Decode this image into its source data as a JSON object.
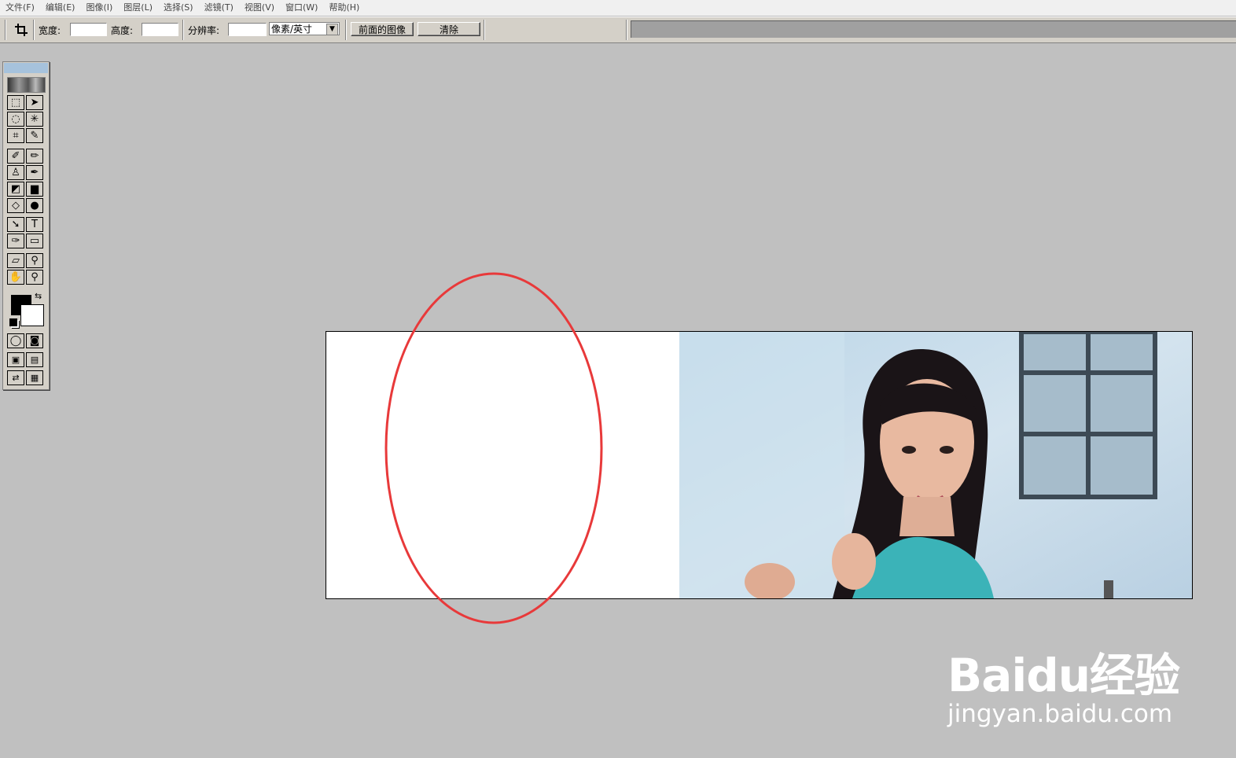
{
  "menubar": {
    "items": [
      "文件(F)",
      "编辑(E)",
      "图像(I)",
      "图层(L)",
      "选择(S)",
      "滤镜(T)",
      "视图(V)",
      "窗口(W)",
      "帮助(H)"
    ]
  },
  "options_bar": {
    "width_label": "宽度:",
    "width_value": "",
    "height_label": "高度:",
    "height_value": "",
    "resolution_label": "分辨率:",
    "resolution_value": "",
    "unit_select": "像素/英寸",
    "front_image_button": "前面的图像",
    "clear_button": "清除"
  },
  "toolbox": {
    "tools": [
      {
        "name": "marquee-tool",
        "glyph": "⬚"
      },
      {
        "name": "move-tool",
        "glyph": "➤"
      },
      {
        "name": "lasso-tool",
        "glyph": "◌"
      },
      {
        "name": "magic-wand-tool",
        "glyph": "✳"
      },
      {
        "name": "crop-tool",
        "glyph": "⌗"
      },
      {
        "name": "slice-tool",
        "glyph": "✎"
      },
      {
        "name": "healing-brush-tool",
        "glyph": "✐"
      },
      {
        "name": "brush-tool",
        "glyph": "✏"
      },
      {
        "name": "clone-stamp-tool",
        "glyph": "♙"
      },
      {
        "name": "history-brush-tool",
        "glyph": "✒"
      },
      {
        "name": "eraser-tool",
        "glyph": "◩"
      },
      {
        "name": "gradient-tool",
        "glyph": "▆"
      },
      {
        "name": "blur-tool",
        "glyph": "◇"
      },
      {
        "name": "dodge-tool",
        "glyph": "●"
      },
      {
        "name": "path-selection-tool",
        "glyph": "➘"
      },
      {
        "name": "type-tool",
        "glyph": "T"
      },
      {
        "name": "pen-tool",
        "glyph": "✑"
      },
      {
        "name": "rectangle-tool",
        "glyph": "▭"
      },
      {
        "name": "notes-tool",
        "glyph": "▱"
      },
      {
        "name": "eyedropper-tool",
        "glyph": "⚲"
      },
      {
        "name": "hand-tool",
        "glyph": "✋"
      },
      {
        "name": "zoom-tool",
        "glyph": "⚲"
      }
    ],
    "foreground_color": "#000000",
    "background_color": "#ffffff"
  },
  "watermark": {
    "logo": "Baidu经验",
    "url": "jingyan.baidu.com"
  },
  "colors": {
    "annotation_ellipse": "#e8393a",
    "workspace": "#c0c0c0"
  }
}
